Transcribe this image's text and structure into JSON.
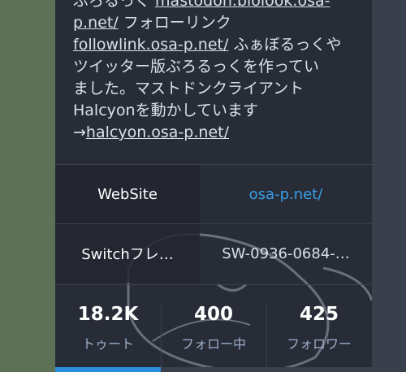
{
  "bio": {
    "line1_text": "ぶろるっく ",
    "line1_link": "mastodon.biolook.osa-",
    "line2_link": "p.net/",
    "line2_text": " フォローリンク",
    "line3_link": "followlink.osa-p.net/",
    "line3_text": " ふぁぼるっくや",
    "line4_text": "ツイッター版ぶろるっくを作ってい",
    "line5_text": "ました。マストドンクライアント",
    "line6_text": "Halcyonを動かしています",
    "line7_arrow": "→",
    "line7_link": "halcyon.osa-p.net/"
  },
  "fields": [
    {
      "name": "WebSite",
      "value": "osa-p.net/"
    },
    {
      "name": "Switchフレ…",
      "value": "SW-0936-0684-…"
    }
  ],
  "counters": [
    {
      "value": "18.2K",
      "label": "トゥート"
    },
    {
      "value": "400",
      "label": "フォロー中"
    },
    {
      "value": "425",
      "label": "フォロワー"
    }
  ],
  "colors": {
    "accent": "#2b90d9",
    "link": "#3a9ee6",
    "card_bg": "#282c37"
  }
}
